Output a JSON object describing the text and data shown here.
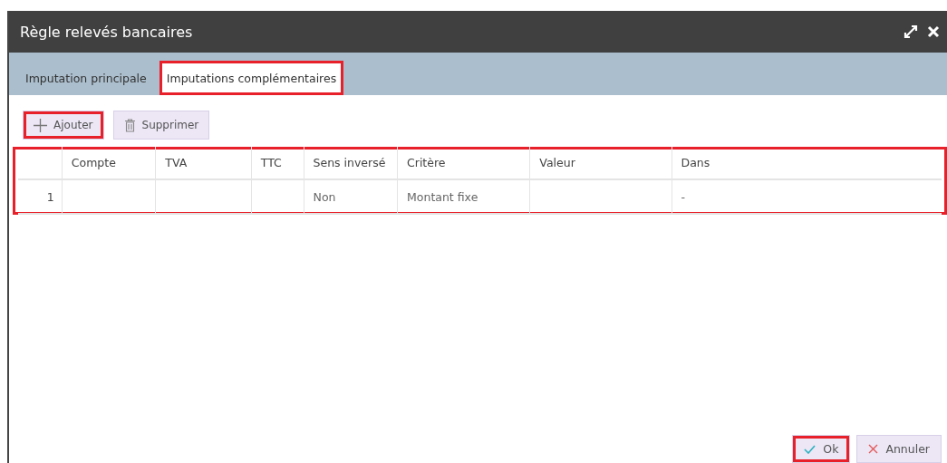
{
  "window": {
    "title": "Règle relevés bancaires"
  },
  "tabs": [
    {
      "label": "Imputation principale",
      "selected": false,
      "highlighted": false
    },
    {
      "label": "Imputations complémentaires",
      "selected": true,
      "highlighted": true
    }
  ],
  "toolbar": [
    {
      "label": "Ajouter",
      "kind": "add",
      "highlighted": true
    },
    {
      "label": "Supprimer",
      "kind": "delete",
      "highlighted": false
    }
  ],
  "table": {
    "highlighted": true,
    "columns": [
      "Compte",
      "TVA",
      "TTC",
      "Sens inversé",
      "Critère",
      "Valeur",
      "Dans"
    ],
    "rows": [
      {
        "number": "1",
        "cells": [
          "",
          "",
          "",
          "Non",
          "Montant fixe",
          "",
          "-"
        ]
      }
    ]
  },
  "buttons": [
    {
      "label": "Ok",
      "kind": "ok",
      "highlighted": true
    },
    {
      "label": "Annuler",
      "kind": "cancel",
      "highlighted": false
    }
  ]
}
